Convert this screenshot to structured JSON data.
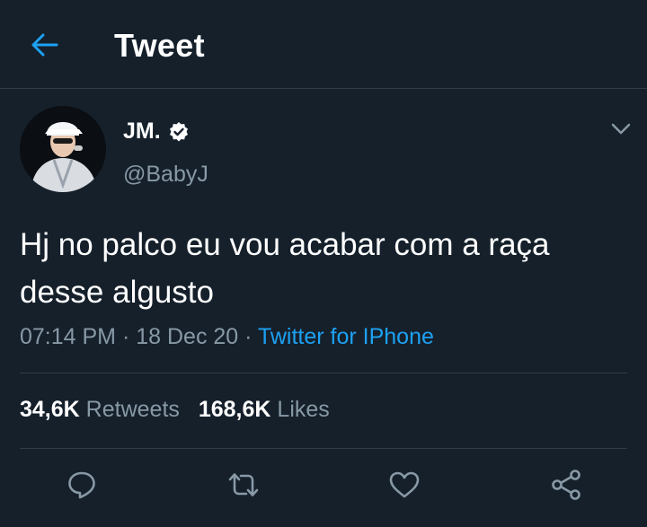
{
  "header": {
    "title": "Tweet",
    "back_icon": "arrow-left-icon",
    "accent": "#1da1f2"
  },
  "tweet": {
    "author_name": "JM.",
    "handle": "@BabyJ",
    "verified": true,
    "text": "Hj no palco eu vou acabar com a raça desse algusto",
    "time": "07:14 PM",
    "date": "18 Dec 20",
    "separator": " · ",
    "source": "Twitter for IPhone"
  },
  "stats": {
    "retweets_count": "34,6K",
    "retweets_label": "Retweets",
    "likes_count": "168,6K",
    "likes_label": "Likes"
  },
  "actions": [
    "reply-icon",
    "retweet-icon",
    "like-icon",
    "share-icon"
  ],
  "colors": {
    "background": "#15202b",
    "secondary_text": "#8899a6",
    "divider": "#2f3b47",
    "link": "#1da1f2"
  }
}
